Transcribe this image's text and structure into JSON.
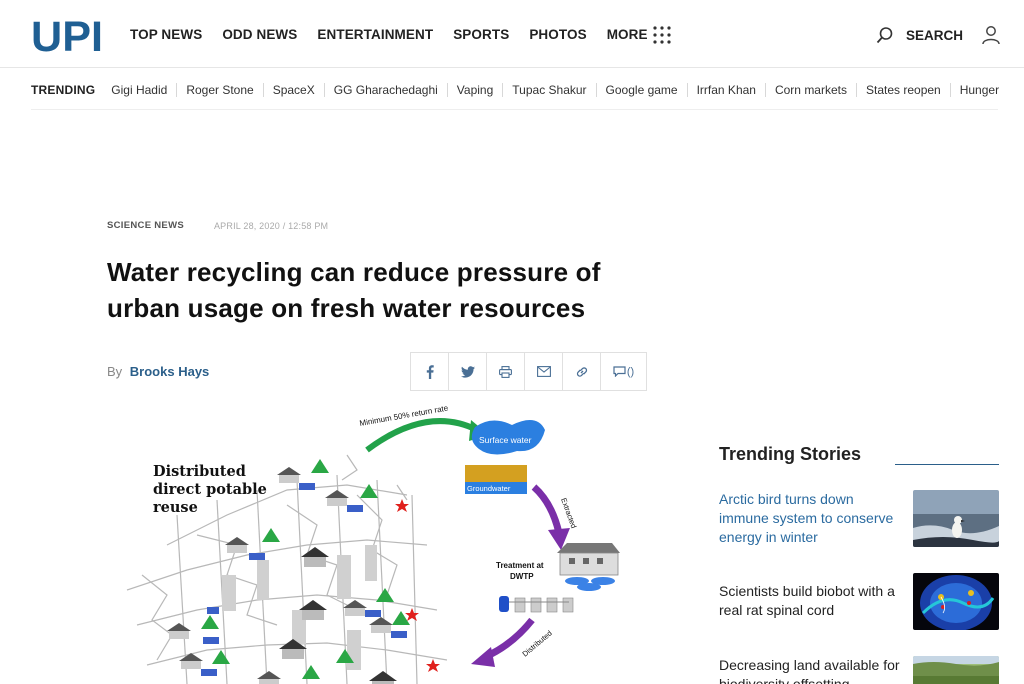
{
  "header": {
    "logo_text": "UPI",
    "nav": [
      "TOP NEWS",
      "ODD NEWS",
      "ENTERTAINMENT",
      "SPORTS",
      "PHOTOS",
      "MORE"
    ],
    "search_label": "SEARCH"
  },
  "trending": {
    "label": "TRENDING",
    "items": [
      "Gigi Hadid",
      "Roger Stone",
      "SpaceX",
      "GG Gharachedaghi",
      "Vaping",
      "Tupac Shakur",
      "Google game",
      "Irrfan Khan",
      "Corn markets",
      "States reopen",
      "Hunger"
    ]
  },
  "article": {
    "category": "SCIENCE NEWS",
    "date": "APRIL 28, 2020 / 12:58 PM",
    "headline": "Water recycling can reduce pressure of urban usage on fresh water resources",
    "byline_prefix": "By",
    "author": "Brooks Hays",
    "comment_count": "()"
  },
  "figure": {
    "label_line1": "Distributed",
    "label_line2": "direct potable",
    "label_line3": "reuse",
    "return_rate": "Minimum 50% return rate",
    "surface_water": "Surface water",
    "groundwater": "Groundwater",
    "extracted": "Extracted",
    "treatment_line1": "Treatment at",
    "treatment_line2": "DWTP",
    "distributed": "Distributed"
  },
  "sidebar": {
    "title": "Trending Stories",
    "stories": [
      {
        "title": "Arctic bird turns down immune system to conserve energy in winter",
        "highlight": true
      },
      {
        "title": "Scientists build biobot with a real rat spinal cord",
        "highlight": false
      },
      {
        "title": "Decreasing land available for biodiversity offsetting",
        "highlight": false
      }
    ]
  },
  "colors": {
    "brand_blue": "#2b6ba0",
    "logo_blue": "#1f5f93",
    "arrow_green": "#22a24a",
    "arrow_purple": "#7a2fa8"
  }
}
